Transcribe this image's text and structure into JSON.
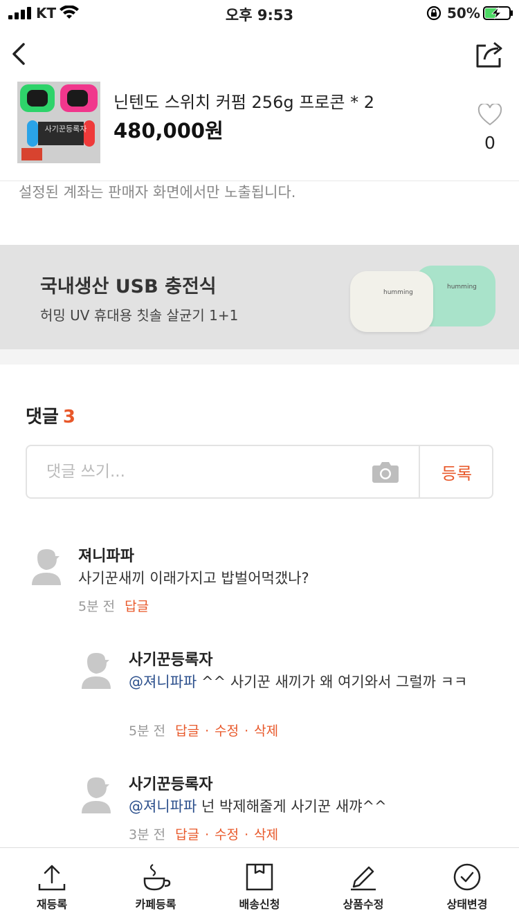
{
  "status_bar": {
    "carrier": "KT",
    "time": "오후 9:53",
    "battery_percent": "50%",
    "battery_level": 0.5
  },
  "product": {
    "title": "닌텐도 스위치 커펌 256g 프로콘 * 2",
    "price": "480,000원",
    "like_count": "0",
    "thumbnail_watermark": "사기꾼등록자"
  },
  "account_note": "설정된 계좌는 판매자 화면에서만 노출됩니다.",
  "banner": {
    "title": "국내생산 USB 충전식",
    "subtitle": "허밍 UV 휴대용 칫솔 살균기 1+1",
    "brand": "humming"
  },
  "comments_section": {
    "heading": "댓글",
    "count": "3",
    "input_placeholder": "댓글 쓰기...",
    "submit_label": "등록"
  },
  "comments": [
    {
      "author": "져니파파",
      "mention": "",
      "text": "사기꾼새끼 이래가지고 밥벌어먹갰나?",
      "time": "5분 전",
      "actions": [
        "답글"
      ]
    },
    {
      "author": "사기꾼등록자",
      "mention": "@져니파파",
      "text": " ^^ 사기꾼 새끼가 왜 여기와서 그럴까 ㅋㅋ",
      "time": "5분 전",
      "actions": [
        "답글",
        "수정",
        "삭제"
      ]
    },
    {
      "author": "사기꾼등록자",
      "mention": "@져니파파",
      "text": " 넌 박제해줄게 사기꾼 새꺄^^",
      "time": "3분 전",
      "actions": [
        "답글",
        "수정",
        "삭제"
      ]
    }
  ],
  "bottom_bar": {
    "items": [
      {
        "label": "재등록",
        "icon": "upload-icon"
      },
      {
        "label": "카페등록",
        "icon": "coffee-cup-icon"
      },
      {
        "label": "배송신청",
        "icon": "box-icon"
      },
      {
        "label": "상품수정",
        "icon": "pencil-icon"
      },
      {
        "label": "상태변경",
        "icon": "check-circle-icon"
      }
    ]
  },
  "colors": {
    "accent": "#e8582a",
    "mention": "#2b4f8c",
    "banner_bg": "#e2e2e2"
  }
}
